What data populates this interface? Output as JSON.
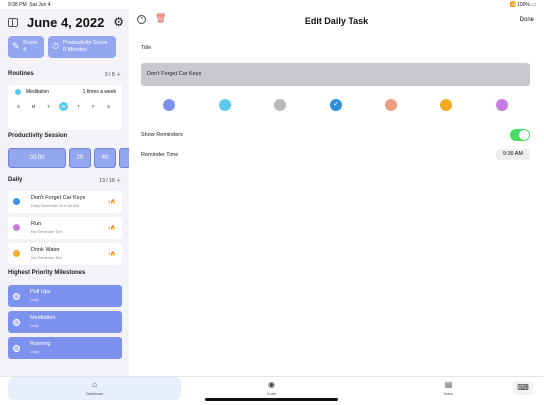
{
  "status": {
    "time": "9:38 PM",
    "date": "Sat Jun 4",
    "battery": "100%"
  },
  "sidebar": {
    "date": "June 4, 2022",
    "score": {
      "line1": "Score",
      "line2": "4"
    },
    "productivity_score": {
      "line1": "Productivity Score",
      "line2": "0 Minutes"
    },
    "routines": {
      "title": "Routines",
      "count": "3 / 8",
      "item": {
        "name": "Meditation",
        "frequency": "1 times a week"
      },
      "days": [
        "S",
        "M",
        "T",
        "W",
        "T",
        "F",
        "S"
      ],
      "active_day_index": 3
    },
    "productivity_session": {
      "title": "Productivity Session",
      "timer": "00:00",
      "options": [
        "20",
        "40"
      ]
    },
    "daily": {
      "title": "Daily",
      "count": "13 / 16",
      "items": [
        {
          "name": "Don't Forget Car Keys",
          "sub": "Daily Reminder At 9:36 AM",
          "badge": "1🔥",
          "color": "#3d8fe0"
        },
        {
          "name": "Run",
          "sub": "No Reminder Set",
          "badge": "1🔥",
          "color": "#c77de0"
        },
        {
          "name": "Drink Water",
          "sub": "No Reminder Set",
          "badge": "1🔥",
          "color": "#f0b030"
        }
      ]
    },
    "milestones": {
      "title": "Highest Priority Milestones",
      "items": [
        {
          "name": "Pull Ups",
          "sub": "Daily"
        },
        {
          "name": "Meditation",
          "sub": "Daily"
        },
        {
          "name": "Running",
          "sub": "Daily"
        }
      ]
    }
  },
  "editor": {
    "title": "Edit Daily Task",
    "done_label": "Done",
    "title_label": "Title",
    "title_value": "Don't Forget Car Keys",
    "colors": [
      "#7d92ee",
      "#5bc9ee",
      "#b9b9bd",
      "#2f8fd8",
      "#ef9d82",
      "#f0a820",
      "#c77de0"
    ],
    "selected_color_index": 3,
    "show_reminders_label": "Show Reminders",
    "show_reminders": true,
    "reminder_time_label": "Reminder Time",
    "reminder_time": "9:36 AM"
  },
  "tabbar": {
    "tabs": [
      {
        "label": "Dashboard",
        "icon": "house-icon"
      },
      {
        "label": "Goals",
        "icon": "target-icon"
      },
      {
        "label": "Notes",
        "icon": "notes-icon"
      }
    ],
    "active": 0
  }
}
